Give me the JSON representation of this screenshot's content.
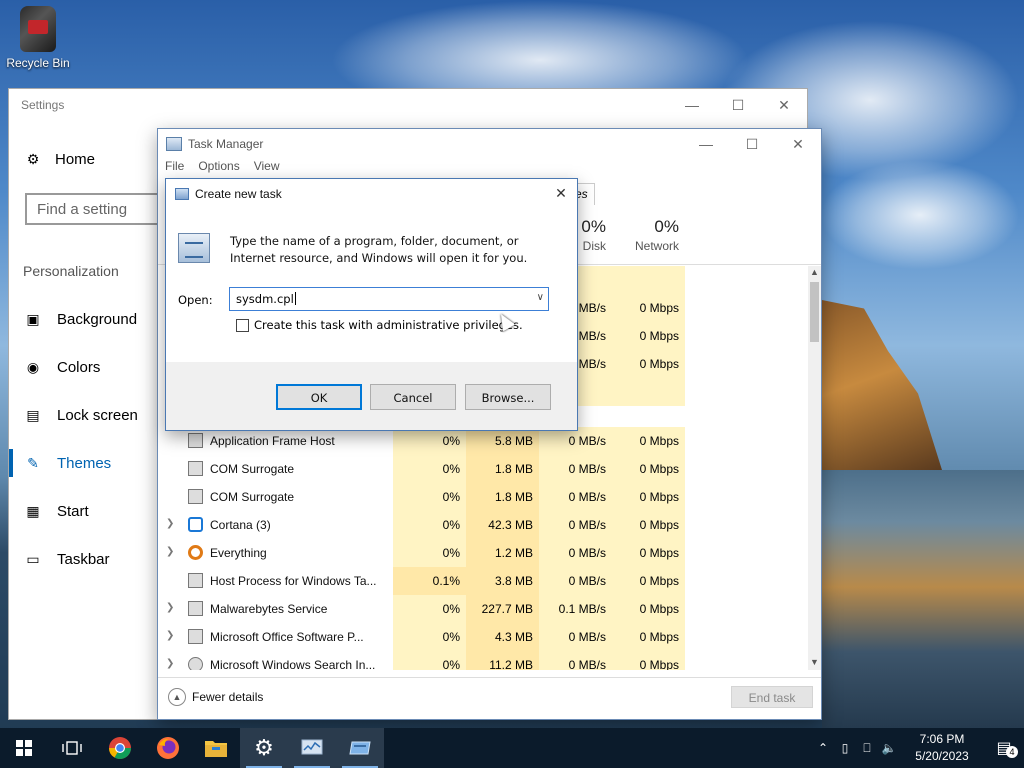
{
  "desktop": {
    "recycle_bin_label": "Recycle Bin"
  },
  "settings": {
    "title": "Settings",
    "home_label": "Home",
    "search_placeholder": "Find a setting",
    "section_label": "Personalization",
    "nav_items": [
      {
        "label": "Background",
        "icon": "image-icon"
      },
      {
        "label": "Colors",
        "icon": "palette-icon"
      },
      {
        "label": "Lock screen",
        "icon": "monitor-icon"
      },
      {
        "label": "Themes",
        "icon": "brush-icon",
        "active": true
      },
      {
        "label": "Start",
        "icon": "start-grid-icon"
      },
      {
        "label": "Taskbar",
        "icon": "taskbar-icon"
      }
    ]
  },
  "task_manager": {
    "title": "Task Manager",
    "menu": [
      "File",
      "Options",
      "View"
    ],
    "tab_fragment": "es",
    "columns": {
      "disk": {
        "pct": "0%",
        "label": "Disk"
      },
      "network": {
        "pct": "0%",
        "label": "Network"
      }
    },
    "partial_rows": [
      {
        "disk": "MB/s",
        "net": "0 Mbps"
      },
      {
        "disk": "MB/s",
        "net": "0 Mbps"
      },
      {
        "disk": "MB/s",
        "net": "0 Mbps"
      }
    ],
    "processes": [
      {
        "name": "Application Frame Host",
        "cpu": "0%",
        "mem": "5.8 MB",
        "disk": "0 MB/s",
        "net": "0 Mbps",
        "expand": false
      },
      {
        "name": "COM Surrogate",
        "cpu": "0%",
        "mem": "1.8 MB",
        "disk": "0 MB/s",
        "net": "0 Mbps",
        "expand": false
      },
      {
        "name": "COM Surrogate",
        "cpu": "0%",
        "mem": "1.8 MB",
        "disk": "0 MB/s",
        "net": "0 Mbps",
        "expand": false
      },
      {
        "name": "Cortana (3)",
        "cpu": "0%",
        "mem": "42.3 MB",
        "disk": "0 MB/s",
        "net": "0 Mbps",
        "expand": true
      },
      {
        "name": "Everything",
        "cpu": "0%",
        "mem": "1.2 MB",
        "disk": "0 MB/s",
        "net": "0 Mbps",
        "expand": true
      },
      {
        "name": "Host Process for Windows Ta...",
        "cpu": "0.1%",
        "mem": "3.8 MB",
        "disk": "0 MB/s",
        "net": "0 Mbps",
        "expand": false
      },
      {
        "name": "Malwarebytes Service",
        "cpu": "0%",
        "mem": "227.7 MB",
        "disk": "0.1 MB/s",
        "net": "0 Mbps",
        "expand": true
      },
      {
        "name": "Microsoft Office Software P...",
        "cpu": "0%",
        "mem": "4.3 MB",
        "disk": "0 MB/s",
        "net": "0 Mbps",
        "expand": true
      },
      {
        "name": "Microsoft Windows Search In...",
        "cpu": "0%",
        "mem": "11.2 MB",
        "disk": "0 MB/s",
        "net": "0 Mbps",
        "expand": true
      }
    ],
    "fewer_details_label": "Fewer details",
    "end_task_label": "End task"
  },
  "dialog": {
    "title": "Create new task",
    "description": "Type the name of a program, folder, document, or Internet resource, and Windows will open it for you.",
    "open_label": "Open:",
    "open_value": "sysdm.cpl",
    "admin_checkbox_label": "Create this task with administrative privileges.",
    "admin_checked": false,
    "ok_label": "OK",
    "cancel_label": "Cancel",
    "browse_label": "Browse..."
  },
  "taskbar": {
    "time": "7:06 PM",
    "date": "5/20/2023",
    "notification_count": "4"
  }
}
